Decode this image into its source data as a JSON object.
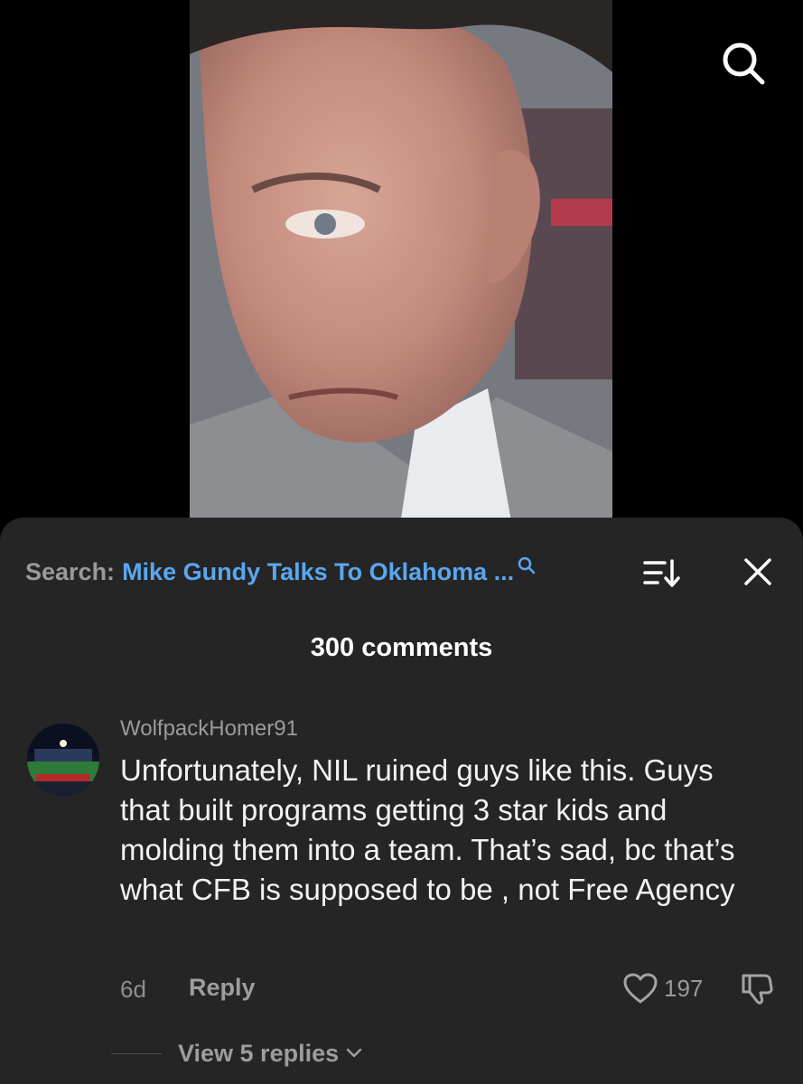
{
  "video": {
    "search_icon": "search-icon"
  },
  "comments_sheet": {
    "search_prefix": "Search:",
    "search_query": "Mike Gundy Talks To Oklahoma ...",
    "search_query_icon": "search-icon",
    "sort_icon": "sort-icon",
    "close_icon": "close-icon",
    "count_label": "300 comments"
  },
  "comment": {
    "username": "WolfpackHomer91",
    "text": "Unfortunately, NIL ruined guys like this. Guys that built programs getting 3 star kids and molding them into a team. That’s sad, bc that’s what CFB is supposed to be , not Free Agency",
    "time": "6d",
    "reply_label": "Reply",
    "like_count": "197",
    "like_icon": "heart-icon",
    "dislike_icon": "thumbs-down-icon",
    "view_replies_label": "View 5 replies"
  },
  "colors": {
    "sheet_bg": "#252525",
    "accent_link": "#5aa7f0",
    "muted_text": "#9b9b9b"
  }
}
